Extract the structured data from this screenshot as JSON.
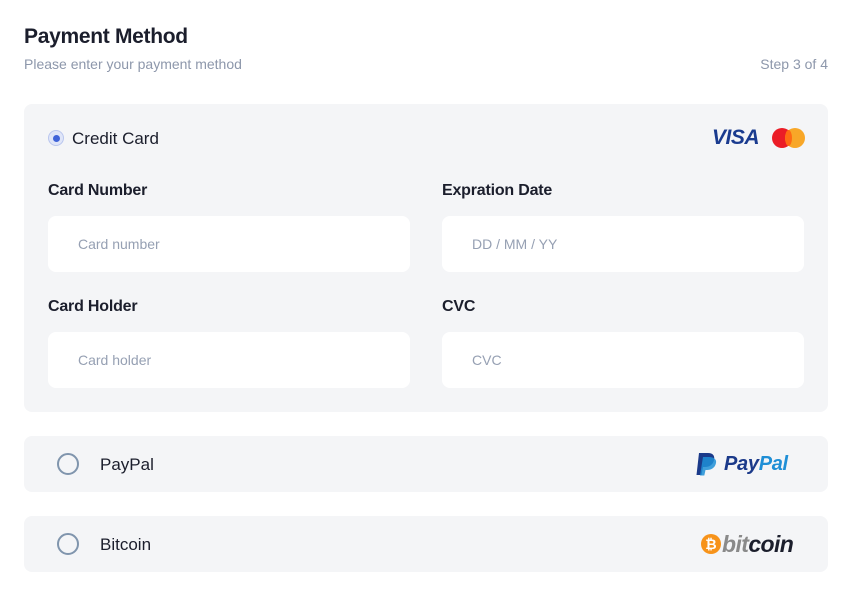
{
  "header": {
    "title": "Payment Method",
    "subtitle": "Please enter your payment method",
    "step": "Step 3 of 4"
  },
  "options": {
    "credit_card": {
      "label": "Credit Card",
      "selected": true,
      "brands": [
        "visa-logo",
        "mastercard-logo"
      ],
      "visa_text": "VISA",
      "fields": {
        "card_number": {
          "label": "Card Number",
          "placeholder": "Card number",
          "value": ""
        },
        "expiration": {
          "label": "Expration Date",
          "placeholder": "DD / MM / YY",
          "value": ""
        },
        "card_holder": {
          "label": "Card Holder",
          "placeholder": "Card holder",
          "value": ""
        },
        "cvc": {
          "label": "CVC",
          "placeholder": "CVC",
          "value": ""
        }
      }
    },
    "paypal": {
      "label": "PayPal",
      "selected": false,
      "logo_part1": "Pay",
      "logo_part2": "Pal"
    },
    "bitcoin": {
      "label": "Bitcoin",
      "selected": false,
      "logo_symbol": "₿",
      "logo_part1": "bit",
      "logo_part2": "coin"
    }
  },
  "colors": {
    "accent": "#3f63d8",
    "panel_bg": "#f4f5f7",
    "muted_text": "#8d97ab",
    "visa_blue": "#1a3b8f",
    "mastercard_red": "#eb1c26",
    "mastercard_orange": "#f8a21c",
    "paypal_dark": "#1b3a8a",
    "paypal_light": "#1f8fd6",
    "bitcoin_orange": "#f7931a"
  }
}
